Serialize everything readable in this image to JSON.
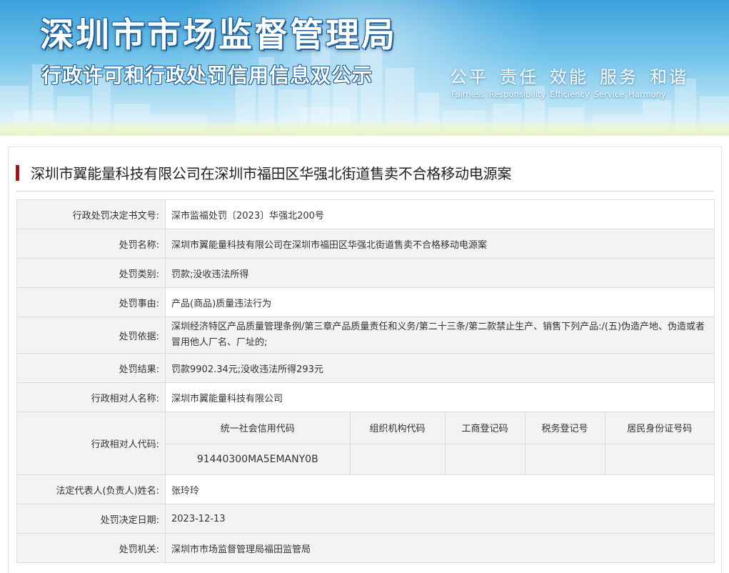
{
  "header": {
    "title_main": "深圳市市场监督管理局",
    "title_sub": "行政许可和行政处罚信用信息双公示",
    "motto_cn": [
      "公平",
      "责任",
      "效能",
      "服务",
      "和谐"
    ],
    "motto_en": [
      "Fairness",
      "Responsibility",
      "Efficiency",
      "Service",
      "Harmony"
    ]
  },
  "case": {
    "title": "深圳市翼能量科技有限公司在深圳市福田区华强北街道售卖不合格移动电源案"
  },
  "fields": {
    "decision_no": {
      "label": "行政处罚决定书文号:",
      "value": "深市监福处罚〔2023〕华强北200号"
    },
    "penalty_name": {
      "label": "处罚名称:",
      "value": "深圳市翼能量科技有限公司在深圳市福田区华强北街道售卖不合格移动电源案"
    },
    "penalty_type": {
      "label": "处罚类别:",
      "value": "罚款;没收违法所得"
    },
    "penalty_reason": {
      "label": "处罚事由:",
      "value": "产品(商品)质量违法行为"
    },
    "penalty_basis": {
      "label": "处罚依据:",
      "value": "深圳经济特区产品质量管理条例/第三章产品质量责任和义务/第二十三条/第二款禁止生产、销售下列产品:/(五)伪造产地、伪造或者冒用他人厂名、厂址的;"
    },
    "penalty_result": {
      "label": "处罚结果:",
      "value": "罚款9902.34元;没收违法所得293元"
    },
    "party_name": {
      "label": "行政相对人名称:",
      "value": "深圳市翼能量科技有限公司"
    },
    "party_code": {
      "label": "行政相对人代码:"
    },
    "legal_rep": {
      "label": "法定代表人(负责人)姓名:",
      "value": "张玲玲"
    },
    "decision_date": {
      "label": "处罚决定日期:",
      "value": "2023-12-13"
    },
    "authority": {
      "label": "处罚机关:",
      "value": "深圳市市场监督管理局福田监管局"
    }
  },
  "codes": {
    "headers": [
      "统一社会信用代码",
      "组织机构代码",
      "工商登记码",
      "税务登记号",
      "居民身份证号码"
    ],
    "values": [
      "91440300MA5EMANY0B",
      "",
      "",
      "",
      ""
    ]
  }
}
